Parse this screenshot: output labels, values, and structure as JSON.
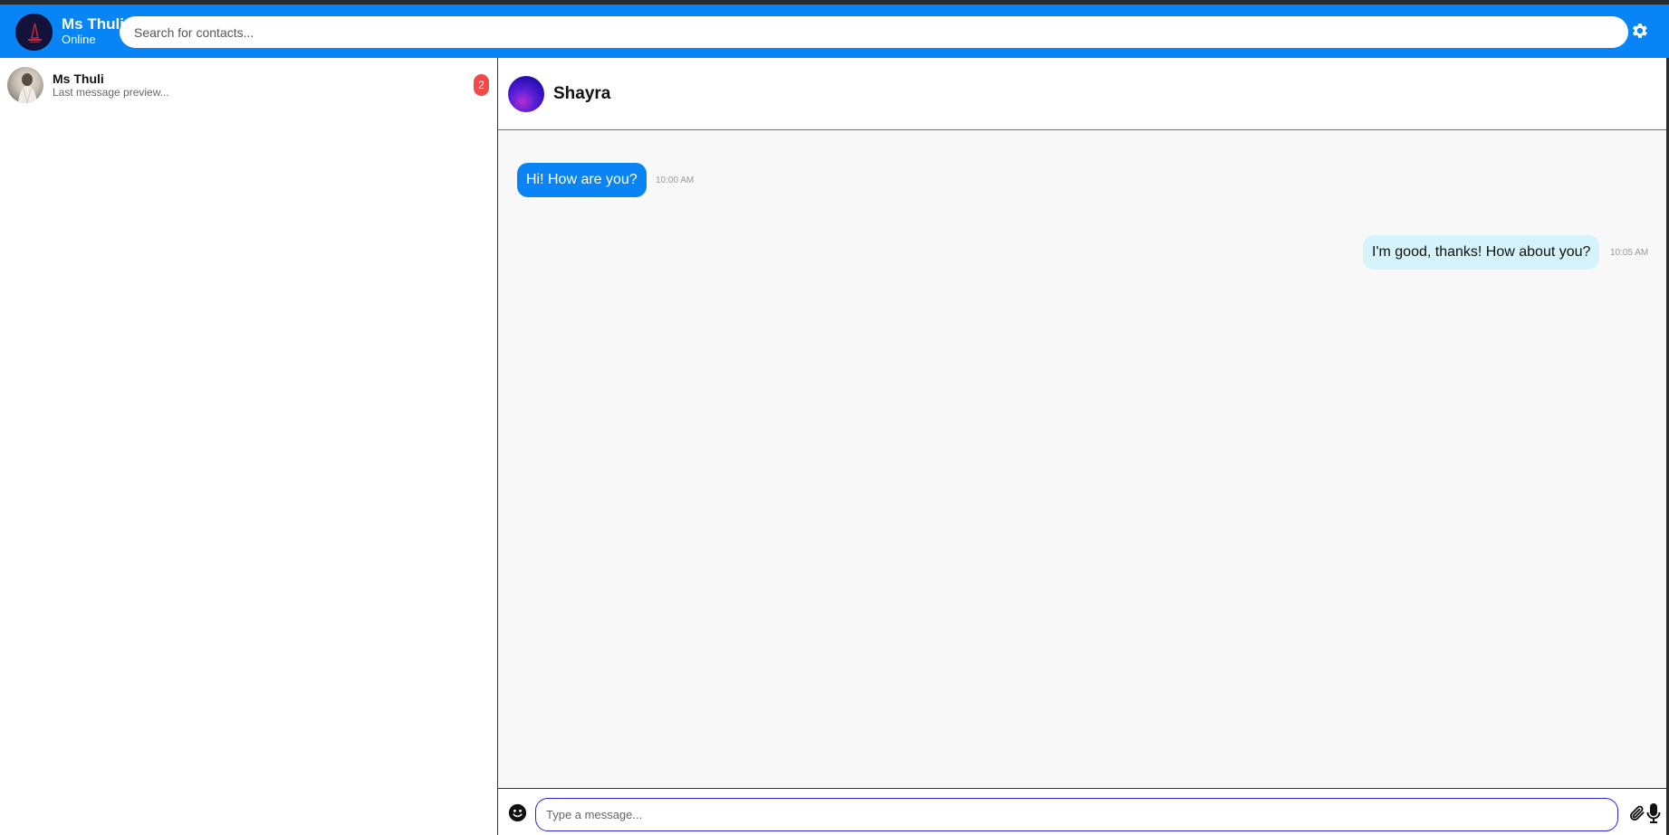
{
  "header": {
    "user_name": "Ms Thuli",
    "user_status": "Online",
    "search_placeholder": "Search for contacts...",
    "settings_icon": "gear-icon",
    "accent_color": "#0784f6"
  },
  "sidebar": {
    "contacts": [
      {
        "name": "Ms Thuli",
        "preview": "Last message preview...",
        "unread": "2"
      }
    ]
  },
  "chat": {
    "title": "Shayra",
    "messages": [
      {
        "direction": "incoming",
        "text": "Hi! How are you?",
        "time": "10:00 AM",
        "color": "#0a84f4"
      },
      {
        "direction": "outgoing",
        "text": "I'm good, thanks! How about you?",
        "time": "10:05 AM",
        "color": "#d5f3fb"
      }
    ]
  },
  "composer": {
    "placeholder": "Type a message...",
    "emoji_icon": "emoji-icon",
    "attach_icon": "paperclip-icon",
    "mic_icon": "microphone-icon"
  }
}
